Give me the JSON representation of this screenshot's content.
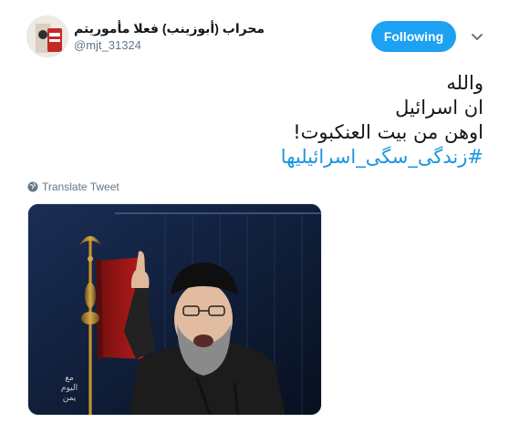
{
  "user": {
    "display_name": "محراب (أبوزينب) فعلا مأموريتم",
    "handle": "@mjt_31324"
  },
  "actions": {
    "follow_label": "Following",
    "menu_icon": "chevron-down-icon"
  },
  "tweet": {
    "lines": [
      "والله",
      "ان اسرائیل",
      "اوهن من بیت العنکبوت!"
    ],
    "hashtag": "#زندگی_سگی_اسرائیلیها",
    "translate_label": "Translate Tweet"
  },
  "media": {
    "watermark_lines": [
      "مع",
      "اليوم",
      "يمن"
    ]
  },
  "colors": {
    "accent": "#1da1f2",
    "link": "#1b95e0",
    "muted": "#657786"
  }
}
